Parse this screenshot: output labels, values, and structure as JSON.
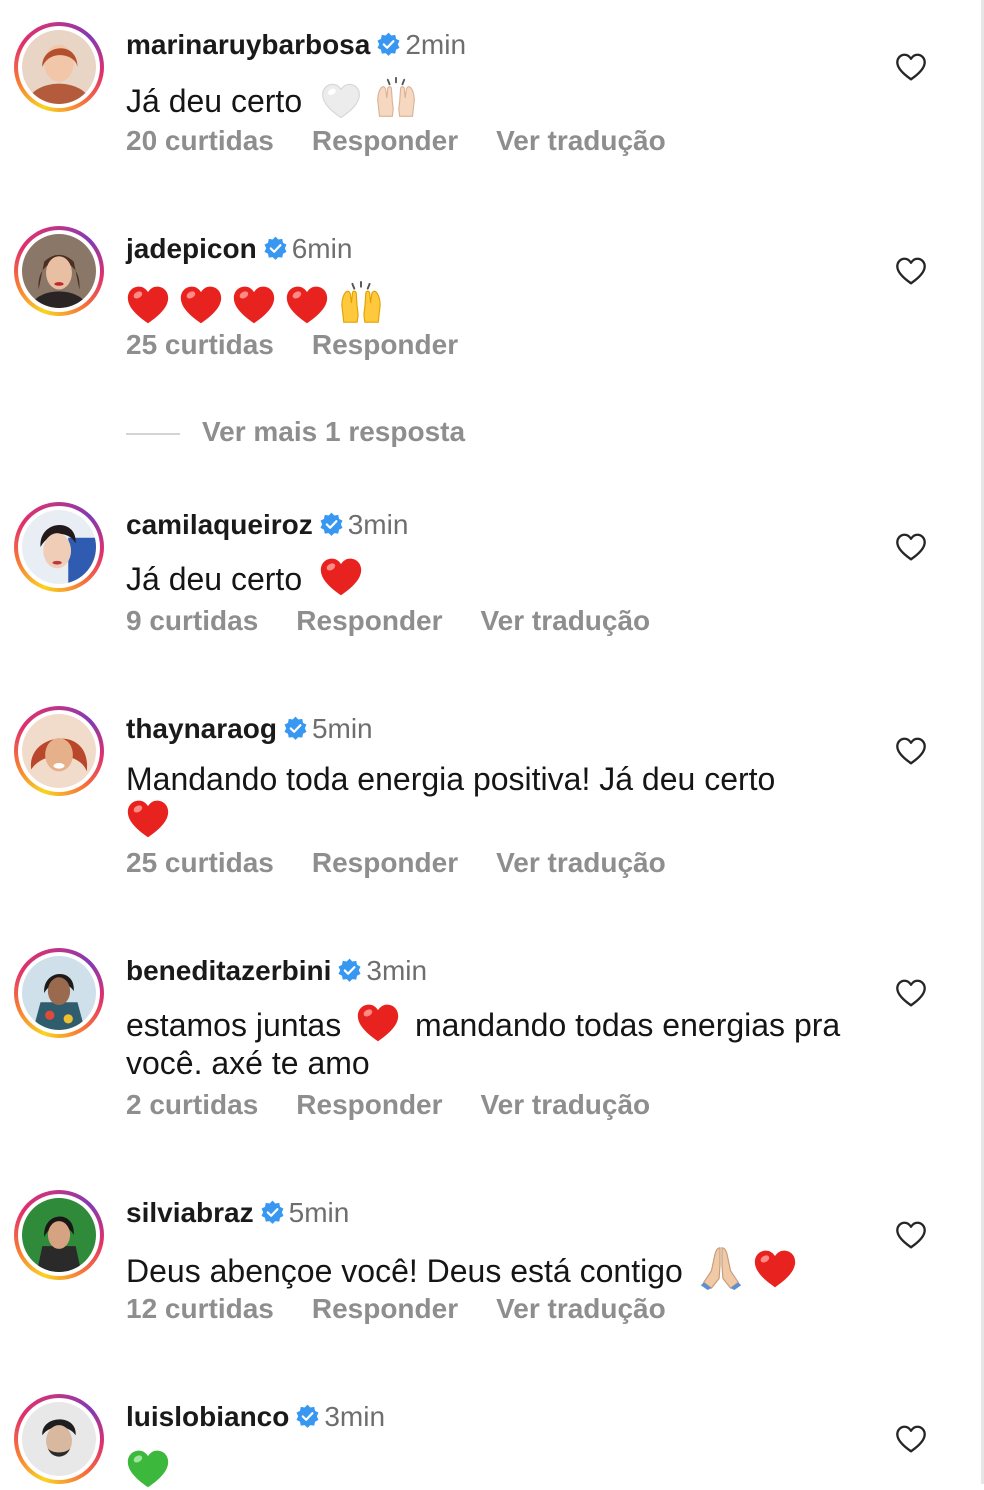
{
  "comments": [
    {
      "username": "marinaruybarbosa",
      "time": "2min",
      "text": "Já deu certo",
      "emojis": [
        "white-heart",
        "raising-hands-light"
      ],
      "likes": "20 curtidas",
      "reply": "Responder",
      "translate": "Ver tradução",
      "avatar_bg": "#c98f6e"
    },
    {
      "username": "jadepicon",
      "time": "6min",
      "text": "",
      "emojis": [
        "red-heart",
        "red-heart",
        "red-heart",
        "red-heart",
        "raising-hands"
      ],
      "likes": "25 curtidas",
      "reply": "Responder",
      "translate": "",
      "avatar_bg": "#6b4a3a"
    },
    {
      "username": "camilaqueiroz",
      "time": "3min",
      "text": "Já deu certo",
      "emojis": [
        "red-heart"
      ],
      "likes": "9 curtidas",
      "reply": "Responder",
      "translate": "Ver tradução",
      "avatar_bg": "#3b5ea8"
    },
    {
      "username": "thaynaraog",
      "time": "5min",
      "text": "Mandando toda energia positiva! Já deu certo",
      "emojis": [
        "red-heart"
      ],
      "likes": "25 curtidas",
      "reply": "Responder",
      "translate": "Ver tradução",
      "avatar_bg": "#d48a55"
    },
    {
      "username": "beneditazerbini",
      "time": "3min",
      "text_before": "estamos juntas",
      "text_after": "mandando todas energias pra você. axé te amo",
      "emojis": [
        "red-heart"
      ],
      "likes": "2 curtidas",
      "reply": "Responder",
      "translate": "Ver tradução",
      "avatar_bg": "#3f6f86"
    },
    {
      "username": "silviabraz",
      "time": "5min",
      "text": "Deus abençoe você! Deus está contigo",
      "emojis": [
        "folded-hands-light",
        "red-heart"
      ],
      "likes": "12 curtidas",
      "reply": "Responder",
      "translate": "Ver tradução",
      "avatar_bg": "#2f8a3a"
    },
    {
      "username": "luislobianco",
      "time": "3min",
      "text": "",
      "emojis": [
        "green-heart"
      ],
      "avatar_bg": "#d9d9d9"
    }
  ],
  "more_replies": "Ver mais 1 resposta",
  "colors": {
    "verified": "#3897f0",
    "secondary_text": "#8e8e8e",
    "red_heart": "#e8231f",
    "green_heart": "#3cb83c"
  },
  "icons": {
    "verified": "verified-badge-icon",
    "like": "heart-outline-icon"
  }
}
